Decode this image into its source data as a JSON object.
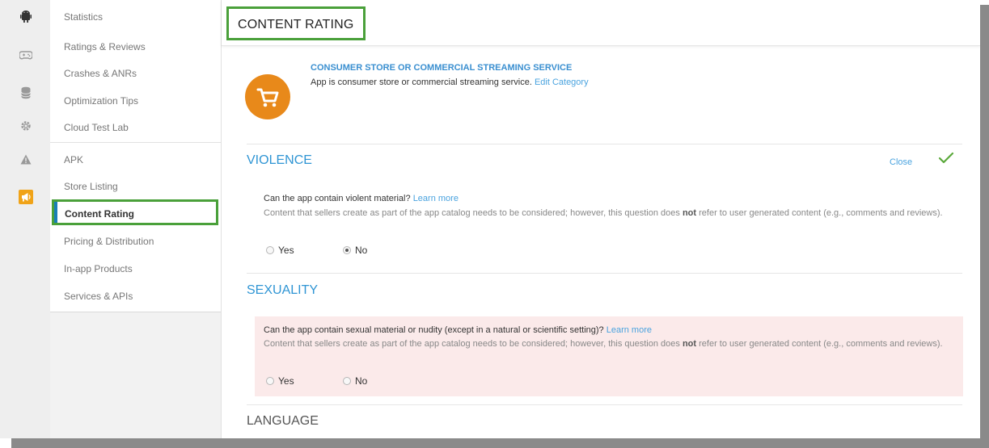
{
  "rail_icons": [
    "android-icon",
    "gamepad-icon",
    "database-icon",
    "settings-icon",
    "alert-icon",
    "megaphone-icon"
  ],
  "nav": {
    "items": [
      "Statistics",
      "Ratings & Reviews",
      "Crashes & ANRs",
      "Optimization Tips",
      "Cloud Test Lab",
      "APK",
      "Store Listing",
      "Content Rating",
      "Pricing & Distribution",
      "In-app Products",
      "Services & APIs"
    ],
    "active_index": 7
  },
  "page_title": "CONTENT RATING",
  "category": {
    "icon": "shopping-cart-icon",
    "title": "CONSUMER STORE OR COMMERCIAL STREAMING SERVICE",
    "description": "App is consumer store or commercial streaming service.",
    "edit_link": "Edit Category"
  },
  "violence": {
    "heading": "VIOLENCE",
    "close_label": "Close",
    "question": "Can the app contain violent material?",
    "learn_more": "Learn more",
    "note_before": "Content that sellers create as part of the app catalog needs to be considered; however, this question does",
    "note_bold": "not",
    "note_after": "refer to user generated content (e.g., comments and reviews).",
    "yes_label": "Yes",
    "no_label": "No",
    "selected": "No"
  },
  "sexuality": {
    "heading": "SEXUALITY",
    "question": "Can the app contain sexual material or nudity (except in a natural or scientific setting)?",
    "learn_more": "Learn more",
    "note_before": "Content that sellers create as part of the app catalog needs to be considered; however, this question does",
    "note_bold": "not",
    "note_after": "refer to user generated content (e.g., comments and reviews).",
    "yes_label": "Yes",
    "no_label": "No",
    "selected": ""
  },
  "language": {
    "heading": "LANGUAGE"
  },
  "colors": {
    "accent_green": "#4aa03a",
    "link_blue": "#4aa3df",
    "heading_blue": "#2f95d4",
    "category_orange": "#e8891a",
    "highlight_pink": "#fbeaea"
  }
}
